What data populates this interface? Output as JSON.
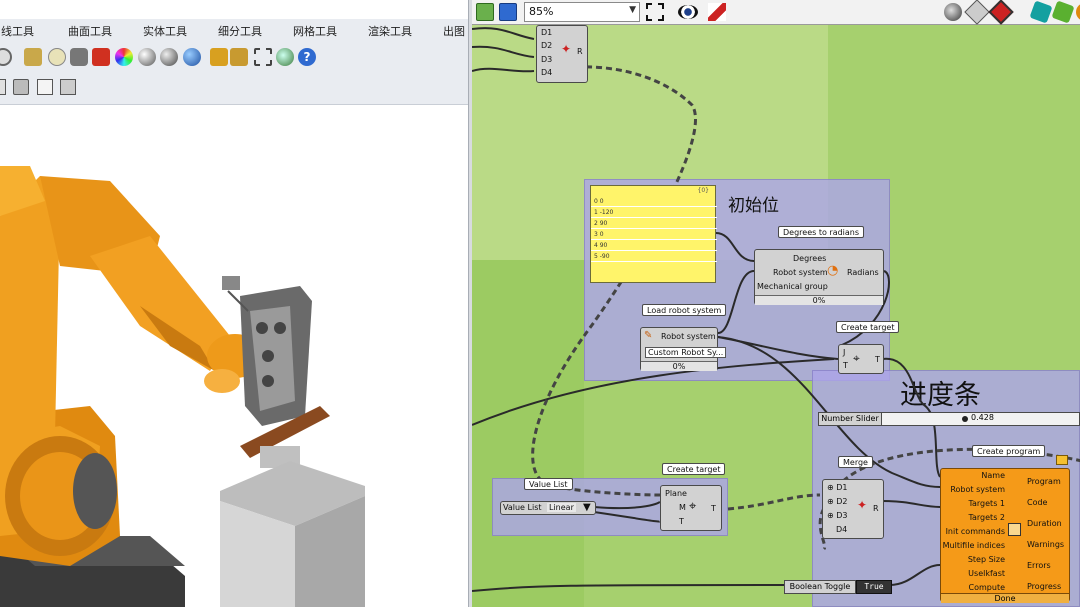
{
  "rhino": {
    "tabs": [
      "曲线工具",
      "曲面工具",
      "实体工具",
      "细分工具",
      "网格工具",
      "渲染工具",
      "出图"
    ]
  },
  "gh": {
    "zoom": "85%",
    "groups": {
      "initial_label": "初始位",
      "progress_label": "进度条"
    },
    "panel": {
      "header": "{0}",
      "rows": [
        "0  0",
        "1  -120",
        "2  90",
        "3  0",
        "4  90",
        "5  -90"
      ]
    },
    "top_component": {
      "inputs": [
        "D1",
        "D2",
        "D3",
        "D4"
      ],
      "output": "R"
    },
    "deg_to_rad": {
      "title": "Degrees to radians",
      "inputs": [
        "Degrees",
        "Robot system",
        "Mechanical group"
      ],
      "output": "Radians",
      "progress": "0%"
    },
    "load_robot": {
      "title": "Load robot system",
      "output": "Robot system",
      "value": "Custom Robot Sy...",
      "progress": "0%"
    },
    "create_target_top": {
      "title": "Create target",
      "inputs": [
        "J",
        "T"
      ],
      "output": "T"
    },
    "create_target_bottom": {
      "title": "Create target",
      "inputs": [
        "Plane",
        "M",
        "T"
      ],
      "output": "T"
    },
    "value_list": {
      "title": "Value List",
      "label": "Value List",
      "value": "Linear"
    },
    "merge": {
      "title": "Merge",
      "inputs": [
        "D1",
        "D2",
        "D3",
        "D4"
      ],
      "output": "R"
    },
    "number_slider": {
      "label": "Number Slider",
      "value": "0.428"
    },
    "create_program": {
      "title": "Create program",
      "inputs": [
        "Name",
        "Robot system",
        "Targets 1",
        "Targets 2",
        "Init commands",
        "Multifile indices",
        "Step Size",
        "Uselkfast",
        "Compute"
      ],
      "outputs": [
        "Program",
        "Code",
        "Duration",
        "Warnings",
        "Errors",
        "Progress"
      ],
      "status": "Done"
    },
    "boolean_toggle": {
      "label": "Boolean Toggle",
      "value": "True"
    }
  }
}
